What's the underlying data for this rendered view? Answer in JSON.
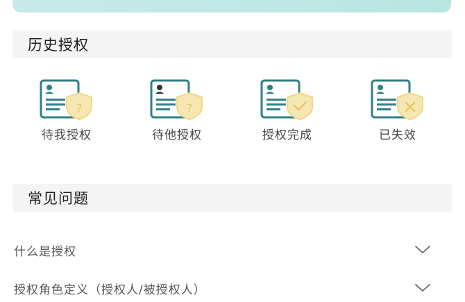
{
  "history": {
    "title": "历史授权",
    "items": [
      {
        "label": "待我授权",
        "icon": "document-question-shield-icon"
      },
      {
        "label": "待他授权",
        "icon": "document-question-shield-icon"
      },
      {
        "label": "授权完成",
        "icon": "document-check-shield-icon"
      },
      {
        "label": "已失效",
        "icon": "document-cross-shield-icon"
      }
    ]
  },
  "faq": {
    "title": "常见问题",
    "items": [
      {
        "question": "什么是授权"
      },
      {
        "question": "授权角色定义（授权人/被授权人）"
      }
    ]
  },
  "colors": {
    "teal": "#2f7f86",
    "shield_yellow": "#f3df9a",
    "banner": "#c7e9ea"
  }
}
